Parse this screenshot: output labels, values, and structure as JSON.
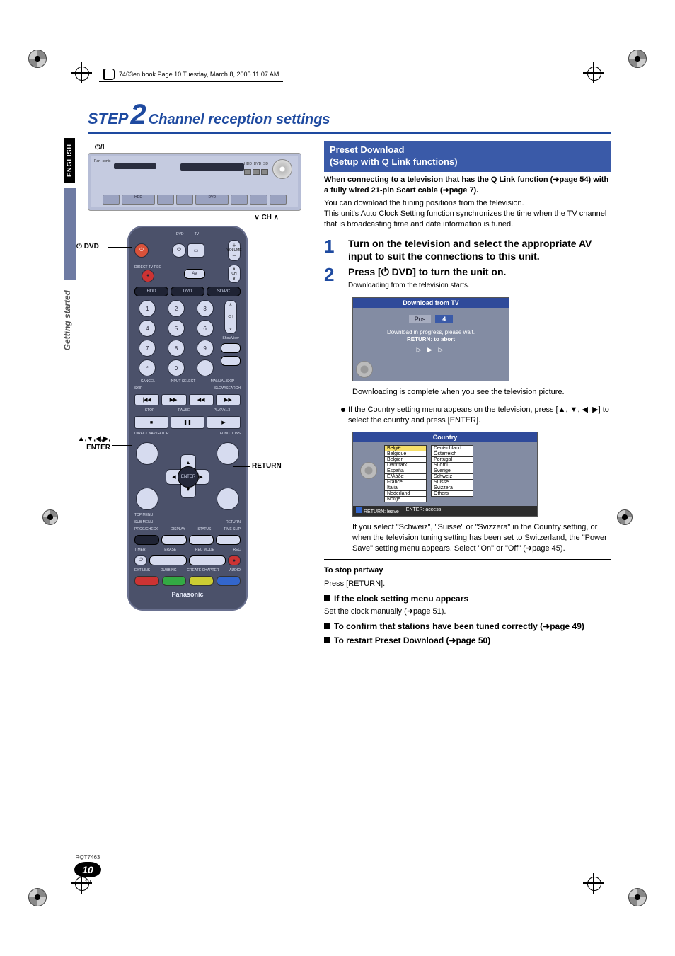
{
  "book_header": "7463en.book  Page 10  Tuesday, March 8, 2005  11:07 AM",
  "side": {
    "language_tab": "ENGLISH",
    "section_label": "Getting started"
  },
  "title": {
    "step_word": "STEP",
    "step_num": "2",
    "rest": "Channel reception settings"
  },
  "device": {
    "power_label": "⏻/I",
    "ch_label": "∨ CH ∧"
  },
  "remote": {
    "dvd_label": "⏻ DVD",
    "enter_label": "▲,▼,◀,▶,\nENTER",
    "return_label": "RETURN",
    "top_labels": {
      "dvd": "DVD",
      "tv": "TV"
    },
    "row_direct": {
      "left": "DIRECT TV REC",
      "av": "AV",
      "vol": "VOLUME",
      "ch": "CH"
    },
    "drive_row": {
      "hdd": "HDD",
      "dvd": "DVD",
      "sdpc": "SD/PC"
    },
    "numbers": [
      "1",
      "2",
      "3",
      "4",
      "5",
      "6",
      "7",
      "8",
      "9",
      "*",
      "0"
    ],
    "num_side": {
      "ch": "CH",
      "showview": "ShowView"
    },
    "num_row_labels": {
      "cancel": "CANCEL",
      "input": "INPUT SELECT",
      "manual": "MANUAL SKIP"
    },
    "skip_row": {
      "skip": "SKIP",
      "slow": "SLOW/SEARCH"
    },
    "transport": {
      "stop": "STOP",
      "pause": "PAUSE",
      "play": "PLAY/x1.3",
      "rew": "◀◀",
      "fwd": "▶▶",
      "prev": "|◀◀",
      "next": "▶▶|"
    },
    "dpad": {
      "direct_nav": "DIRECT NAVIGATOR",
      "top_menu": "TOP MENU",
      "functions": "FUNCTIONS",
      "sub_menu": "SUB MENU",
      "return": "RETURN",
      "enter": "ENTER"
    },
    "bottom_row1": {
      "prog": "PROG/CHECK",
      "display": "DISPLAY",
      "status": "STATUS",
      "timeslip": "TIME SLIP"
    },
    "bottom_row2": {
      "timer": "TIMER",
      "erase": "ERASE",
      "recmode": "REC MODE",
      "rec": "REC"
    },
    "bottom_row3": {
      "extlink": "EXT LINK",
      "dubbing": "DUBBING",
      "chapter": "CREATE CHAPTER",
      "audio": "AUDIO"
    },
    "brand": "Panasonic"
  },
  "right": {
    "blue_box_line1": "Preset Download",
    "blue_box_line2": "(Setup with Q Link functions)",
    "intro_bold": "When connecting to a television that has the Q Link function (➜page 54) with a fully wired 21-pin Scart cable (➜page 7).",
    "intro_body": "You can download the tuning positions from the television.\nThis unit's Auto Clock Setting function synchronizes the time when the TV channel that is broadcasting time and date information is tuned.",
    "steps": [
      {
        "num": "1",
        "text": "Turn on the television and select the appropriate AV input to suit the connections to this unit."
      },
      {
        "num": "2",
        "text": "Press [⏻ DVD] to turn the unit on.",
        "sub": "Downloading from the television starts."
      }
    ],
    "osd1": {
      "title": "Download from TV",
      "pos_label": "Pos",
      "pos_value": "4",
      "msg1": "Download in progress, please wait.",
      "msg2": "RETURN:  to abort",
      "progress": "▷ ▶ ▷"
    },
    "after_osd1": "Downloading is complete when you see the television picture.",
    "bullet_text": "If the Country setting menu appears on the television, press [▲, ▼, ◀, ▶] to select the country and press [ENTER].",
    "osd2": {
      "title": "Country",
      "col1": [
        "België",
        "Belgique",
        "Belgien",
        "Danmark",
        "España",
        "Eλλάδα",
        "France",
        "Italia",
        "Nederland",
        "Norge"
      ],
      "col2": [
        "Deutschland",
        "Österreich",
        "Portugal",
        "Suomi",
        "Sverige",
        "Schweiz",
        "Suisse",
        "Svizzera",
        "Others"
      ],
      "footer_return": "RETURN: leave",
      "footer_enter": "ENTER: access"
    },
    "after_osd2": "If you select \"Schweiz\", \"Suisse\" or \"Svizzera\" in the Country setting, or when the television tuning setting has been set to Switzerland, the \"Power Save\" setting menu appears. Select \"On\" or \"Off\" (➜page 45).",
    "to_stop_head": "To stop partway",
    "to_stop_body": "Press [RETURN].",
    "clock_head": "If the clock setting menu appears",
    "clock_body": "Set the clock manually (➜page 51).",
    "confirm_head": "To confirm that stations have been tuned correctly (➜page 49)",
    "restart_head": "To restart Preset Download (➜page 50)"
  },
  "footer": {
    "rqt": "RQT7463",
    "page_big": "10",
    "page_small": "10"
  }
}
